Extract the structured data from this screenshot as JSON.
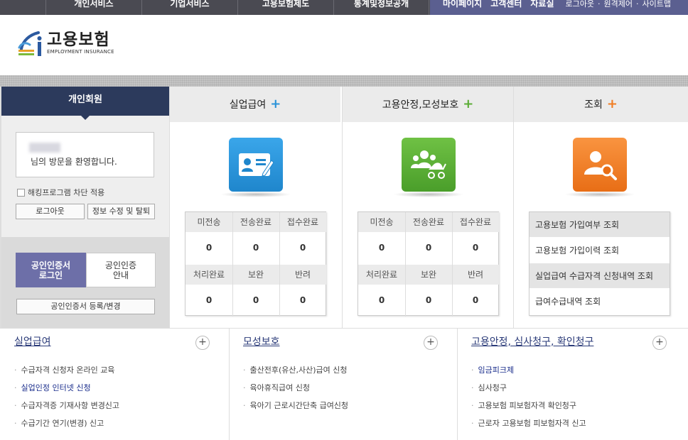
{
  "topnav": {
    "main": [
      "개인서비스",
      "기업서비스",
      "고용보험제도",
      "통계및정보공개"
    ],
    "sub": [
      "마이페이지",
      "고객센터",
      "자료실"
    ],
    "util": [
      "로그아웃",
      "원격제어",
      "사이트맵"
    ],
    "util_sep": "·"
  },
  "logo": {
    "ko": "고용보험",
    "en": "EMPLOYMENT INSURANCE"
  },
  "member": {
    "tab": "개인회원",
    "welcome": "님의 방문을 환영합니다.",
    "hack_block": "해킹프로그램 차단 적용",
    "logout": "로그아웃",
    "edit": "정보 수정 및 탈퇴",
    "cert_login_1": "공인인증서",
    "cert_login_2": "로그인",
    "cert_guide_1": "공인인증",
    "cert_guide_2": "안내",
    "cert_register": "공인인증서 등록/변경"
  },
  "colors": {
    "nav": "#4a4a52",
    "subnav": "#5b5f90",
    "tab": "#2c3a5c",
    "blue": "#2a93d8",
    "green": "#5aac34",
    "orange": "#f07c22"
  },
  "services": [
    {
      "title": "실업급여",
      "plus": "+",
      "icon": "id-card-pen-icon",
      "labels1": [
        "미전송",
        "전송완료",
        "접수완료"
      ],
      "values1": [
        "0",
        "0",
        "0"
      ],
      "labels2": [
        "처리완료",
        "보완",
        "반려"
      ],
      "values2": [
        "0",
        "0",
        "0"
      ]
    },
    {
      "title": "고용안정,모성보호",
      "plus": "+",
      "icon": "family-stroller-icon",
      "labels1": [
        "미전송",
        "전송완료",
        "접수완료"
      ],
      "values1": [
        "0",
        "0",
        "0"
      ],
      "labels2": [
        "처리완료",
        "보완",
        "반려"
      ],
      "values2": [
        "0",
        "0",
        "0"
      ]
    },
    {
      "title": "조회",
      "plus": "+",
      "icon": "person-search-icon",
      "items": [
        "고용보험 가입여부 조회",
        "고용보험 가입이력 조회",
        "실업급여 수급자격 신청내역 조회",
        "급여수급내역 조회"
      ]
    }
  ],
  "bottom": [
    {
      "title": "실업급여",
      "more": "+",
      "items": [
        "수급자격 신청자 온라인 교육",
        "실업인정 인터넷 신청",
        "수급자격증 기재사항 변경신고",
        "수급기간 연기(변경) 신고"
      ]
    },
    {
      "title": "모성보호",
      "more": "+",
      "items": [
        "출산전후(유산,사산)급여 신청",
        "육아휴직급여 신청",
        "육아기 근로시간단축 급여신청"
      ]
    },
    {
      "title": "고용안정, 심사청구, 확인청구",
      "more": "+",
      "items": [
        "임금피크제",
        "심사청구",
        "고용보험 피보험자격 확인청구",
        "근로자 고용보험 피보험자격 신고"
      ]
    }
  ],
  "bullet": "·"
}
